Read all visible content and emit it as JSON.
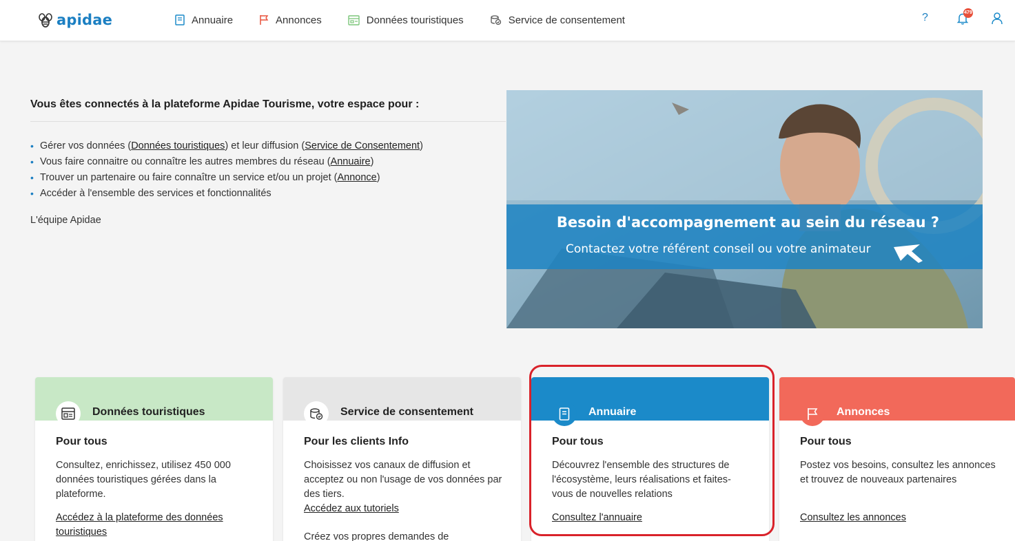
{
  "header": {
    "logo_text": "apidae",
    "nav": [
      {
        "label": "Annuaire",
        "icon": "book-icon"
      },
      {
        "label": "Annonces",
        "icon": "flag-icon"
      },
      {
        "label": "Données touristiques",
        "icon": "database-icon"
      },
      {
        "label": "Service de consentement",
        "icon": "consent-icon"
      }
    ],
    "help_label": "?",
    "notification_count": "479",
    "user_icon": "user-icon"
  },
  "intro": {
    "title": "Vous êtes connectés à la plateforme Apidae Tourisme, votre espace pour :",
    "bullets": [
      {
        "before": "Gérer vos données (",
        "link1": "Données touristiques",
        "middle": ") et leur diffusion (",
        "link2": "Service de Consentement",
        "after": ")"
      },
      {
        "before": "Vous faire connaitre ou connaître les autres membres du réseau (",
        "link1": "Annuaire",
        "after": ")"
      },
      {
        "before": "Trouver un partenaire ou faire connaître un service et/ou un projet (",
        "link1": "Annonce",
        "after": ")"
      },
      {
        "text": "Accéder à l'ensemble des services et fonctionnalités"
      }
    ],
    "signature": "L'équipe Apidae"
  },
  "banner": {
    "heading": "Besoin d'accompagnement au sein du réseau ?",
    "subheading": "Contactez votre référent conseil ou votre animateur"
  },
  "cards": [
    {
      "title": "Données touristiques",
      "subtitle": "Pour tous",
      "text": "Consultez, enrichissez, utilisez 450 000 données touristiques gérées dans la plateforme.",
      "link": "Accédez à la plateforme des données touristiques",
      "color": "#c8e8c6"
    },
    {
      "title": "Service de consentement",
      "subtitle": "Pour les clients Info",
      "text": "Choisissez vos canaux de diffusion et acceptez ou non l'usage de vos données par des tiers.",
      "link": "Accédez aux tutoriels",
      "extra": "Créez vos propres demandes de",
      "color": "#e6e6e6"
    },
    {
      "title": "Annuaire",
      "subtitle": "Pour tous",
      "text": "Découvrez l'ensemble des structures de l'écosystème, leurs réalisations et faites-vous de nouvelles relations",
      "link": "Consultez l'annuaire",
      "color": "#1b8ac9"
    },
    {
      "title": "Annonces",
      "subtitle": "Pour tous",
      "text": "Postez vos besoins, consultez les annonces et trouvez de nouveaux partenaires",
      "link": "Consultez les annonces",
      "color": "#f2695a"
    }
  ]
}
